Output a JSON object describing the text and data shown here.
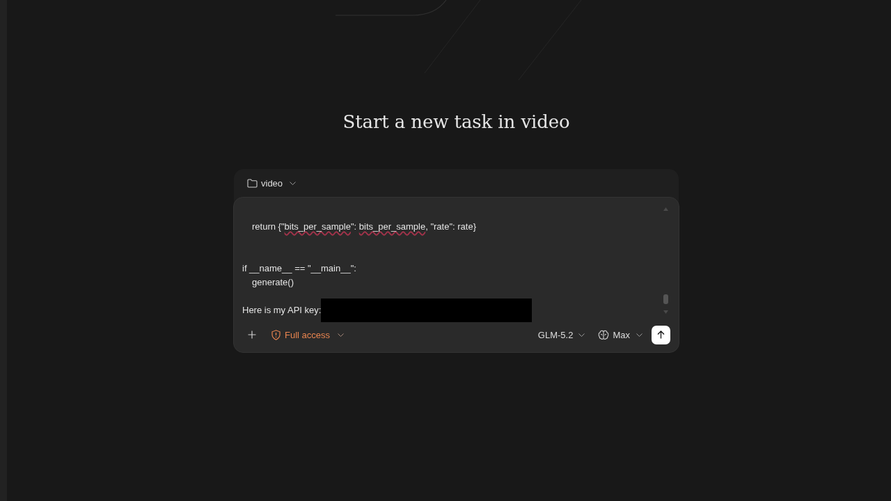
{
  "heading": "Start a new task in video",
  "composer": {
    "folder": {
      "label": "video"
    },
    "message_lines": [
      {
        "kind": "text",
        "indented": true,
        "redacted": false,
        "segments": [
          {
            "text": "return {\"",
            "misspelled": false
          },
          {
            "text": "bits_per_sample",
            "misspelled": true
          },
          {
            "text": "\": ",
            "misspelled": false
          },
          {
            "text": "bits_per_sample",
            "misspelled": true
          },
          {
            "text": ", \"rate\": rate}",
            "misspelled": false
          }
        ]
      },
      {
        "kind": "blank"
      },
      {
        "kind": "blank"
      },
      {
        "kind": "text",
        "indented": false,
        "redacted": false,
        "segments": [
          {
            "text": "if __name__ == \"__main__\":",
            "misspelled": false
          }
        ]
      },
      {
        "kind": "text",
        "indented": true,
        "redacted": false,
        "segments": [
          {
            "text": "generate()",
            "misspelled": false
          }
        ]
      },
      {
        "kind": "blank"
      },
      {
        "kind": "text",
        "indented": false,
        "redacted": true,
        "segments": [
          {
            "text": "Here is my API key:",
            "misspelled": false
          }
        ]
      }
    ],
    "access": {
      "label": "Full access"
    },
    "model": {
      "label": "GLM-5.2"
    },
    "effort": {
      "label": "Max"
    }
  }
}
